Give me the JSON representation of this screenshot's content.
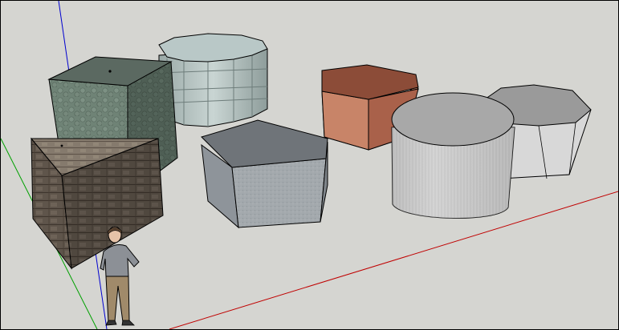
{
  "viewport": {
    "label": ""
  },
  "scene": {
    "objects": [
      {
        "name": "stone-cube",
        "material": "green-stone"
      },
      {
        "name": "glass-octagon-cylinder",
        "material": "blue-glass"
      },
      {
        "name": "wood-triangle-prism",
        "material": "dark-wood-shingle"
      },
      {
        "name": "pentagon-prism",
        "material": "gray-stucco"
      },
      {
        "name": "hexagon-prism",
        "material": "terracotta"
      },
      {
        "name": "metal-cylinder",
        "material": "corrugated-metal"
      },
      {
        "name": "octagon-prism",
        "material": "light-gray"
      },
      {
        "name": "person-scale-figure",
        "material": "figure"
      }
    ],
    "axes": [
      {
        "name": "red-axis",
        "color": "#c00000"
      },
      {
        "name": "green-axis",
        "color": "#00a000"
      },
      {
        "name": "blue-axis",
        "color": "#0000d0"
      }
    ]
  }
}
